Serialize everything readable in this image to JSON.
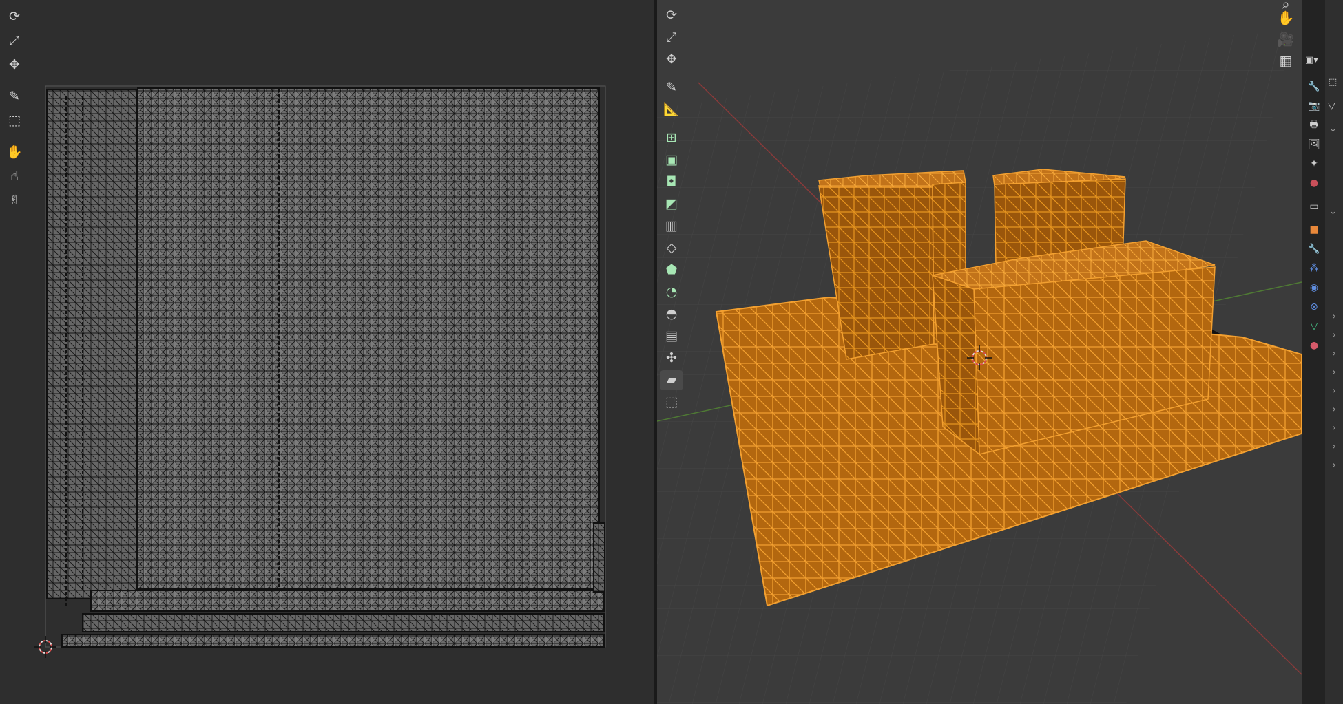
{
  "uv_editor": {
    "tools": [
      {
        "name": "rotate-tool",
        "icon": "rotate-icon",
        "glyph": "⟳"
      },
      {
        "name": "scale-tool",
        "icon": "scale-icon",
        "glyph": "⤢"
      },
      {
        "name": "transform-tool",
        "icon": "transform-icon",
        "glyph": "✥"
      },
      {
        "name": "annotate-tool",
        "icon": "annotate-icon",
        "glyph": "✎"
      },
      {
        "name": "rip-region-tool",
        "icon": "rip-icon",
        "glyph": "⬚"
      },
      {
        "name": "grab-tool",
        "icon": "grab-hand-icon",
        "glyph": "✋"
      },
      {
        "name": "relax-tool",
        "icon": "relax-hand-icon",
        "glyph": "☝"
      },
      {
        "name": "pinch-tool",
        "icon": "pinch-hand-icon",
        "glyph": "✌"
      }
    ]
  },
  "viewport": {
    "tools": [
      {
        "name": "rotate-tool",
        "icon": "rotate-icon",
        "glyph": "⟳",
        "accent": false
      },
      {
        "name": "scale-tool",
        "icon": "scale-icon",
        "glyph": "⤢",
        "accent": false
      },
      {
        "name": "transform-tool",
        "icon": "transform-icon",
        "glyph": "✥",
        "accent": false
      },
      {
        "name": "annotate-tool",
        "icon": "annotate-icon",
        "glyph": "✎",
        "accent": false
      },
      {
        "name": "measure-tool",
        "icon": "ruler-icon",
        "glyph": "📐",
        "accent": false
      },
      {
        "name": "add-cube-tool",
        "icon": "add-cube-icon",
        "glyph": "⊞",
        "accent": true
      },
      {
        "name": "extrude-tool",
        "icon": "extrude-icon",
        "glyph": "▣",
        "accent": true
      },
      {
        "name": "inset-tool",
        "icon": "inset-icon",
        "glyph": "◘",
        "accent": true
      },
      {
        "name": "bevel-tool",
        "icon": "bevel-icon",
        "glyph": "◩",
        "accent": true
      },
      {
        "name": "loop-cut-tool",
        "icon": "loop-cut-icon",
        "glyph": "▥",
        "accent": false
      },
      {
        "name": "knife-tool",
        "icon": "knife-icon",
        "glyph": "◇",
        "accent": false
      },
      {
        "name": "poly-build-tool",
        "icon": "poly-build-icon",
        "glyph": "⬟",
        "accent": true
      },
      {
        "name": "spin-tool",
        "icon": "spin-icon",
        "glyph": "◔",
        "accent": true
      },
      {
        "name": "smooth-tool",
        "icon": "smooth-icon",
        "glyph": "◓",
        "accent": false
      },
      {
        "name": "edge-slide-tool",
        "icon": "edge-slide-icon",
        "glyph": "▤",
        "accent": false
      },
      {
        "name": "shrink-fatten-tool",
        "icon": "shrink-fatten-icon",
        "glyph": "✣",
        "accent": false
      },
      {
        "name": "shear-tool",
        "icon": "shear-icon",
        "glyph": "▰",
        "accent": false
      },
      {
        "name": "rip-region-tool",
        "icon": "rip-icon",
        "glyph": "⬚",
        "accent": false
      }
    ],
    "nav_buttons": [
      {
        "name": "pan-button",
        "icon": "hand-icon",
        "glyph": "✋"
      },
      {
        "name": "camera-view-button",
        "icon": "camera-icon",
        "glyph": "🎥"
      },
      {
        "name": "perspective-toggle-button",
        "icon": "grid-icon",
        "glyph": "▦"
      }
    ]
  },
  "properties": {
    "tabs": [
      {
        "name": "tab-tool",
        "icon": "tool-icon",
        "glyph": "🔧",
        "color": "#cfcfcf"
      },
      {
        "name": "tab-render",
        "icon": "render-icon",
        "glyph": "📷",
        "color": "#cfcfcf"
      },
      {
        "name": "tab-output",
        "icon": "printer-icon",
        "glyph": "🖶",
        "color": "#cfcfcf"
      },
      {
        "name": "tab-view-layer",
        "icon": "view-layer-icon",
        "glyph": "🖼",
        "color": "#cfcfcf"
      },
      {
        "name": "tab-scene",
        "icon": "scene-icon",
        "glyph": "✦",
        "color": "#cfcfcf"
      },
      {
        "name": "tab-world",
        "icon": "world-icon",
        "glyph": "●",
        "color": "#c9505a"
      },
      {
        "name": "tab-collection",
        "icon": "collection-icon",
        "glyph": "▭",
        "color": "#cfcfcf"
      },
      {
        "name": "tab-object",
        "icon": "object-icon",
        "glyph": "■",
        "color": "#e8883a"
      },
      {
        "name": "tab-modifiers",
        "icon": "wrench-icon",
        "glyph": "🔧",
        "color": "#5f8ee0"
      },
      {
        "name": "tab-particles",
        "icon": "particles-icon",
        "glyph": "⁂",
        "color": "#5f8ee0"
      },
      {
        "name": "tab-physics",
        "icon": "physics-icon",
        "glyph": "◉",
        "color": "#5f8ee0"
      },
      {
        "name": "tab-constraints",
        "icon": "constraints-icon",
        "glyph": "⊗",
        "color": "#5f8ee0"
      },
      {
        "name": "tab-data",
        "icon": "mesh-data-icon",
        "glyph": "▽",
        "color": "#49c78a"
      },
      {
        "name": "tab-material",
        "icon": "material-icon",
        "glyph": "●",
        "color": "#d65a6a"
      }
    ],
    "expanders": [
      "›",
      "›",
      "›",
      "›",
      "›",
      "›",
      "›",
      "›",
      "›"
    ]
  }
}
